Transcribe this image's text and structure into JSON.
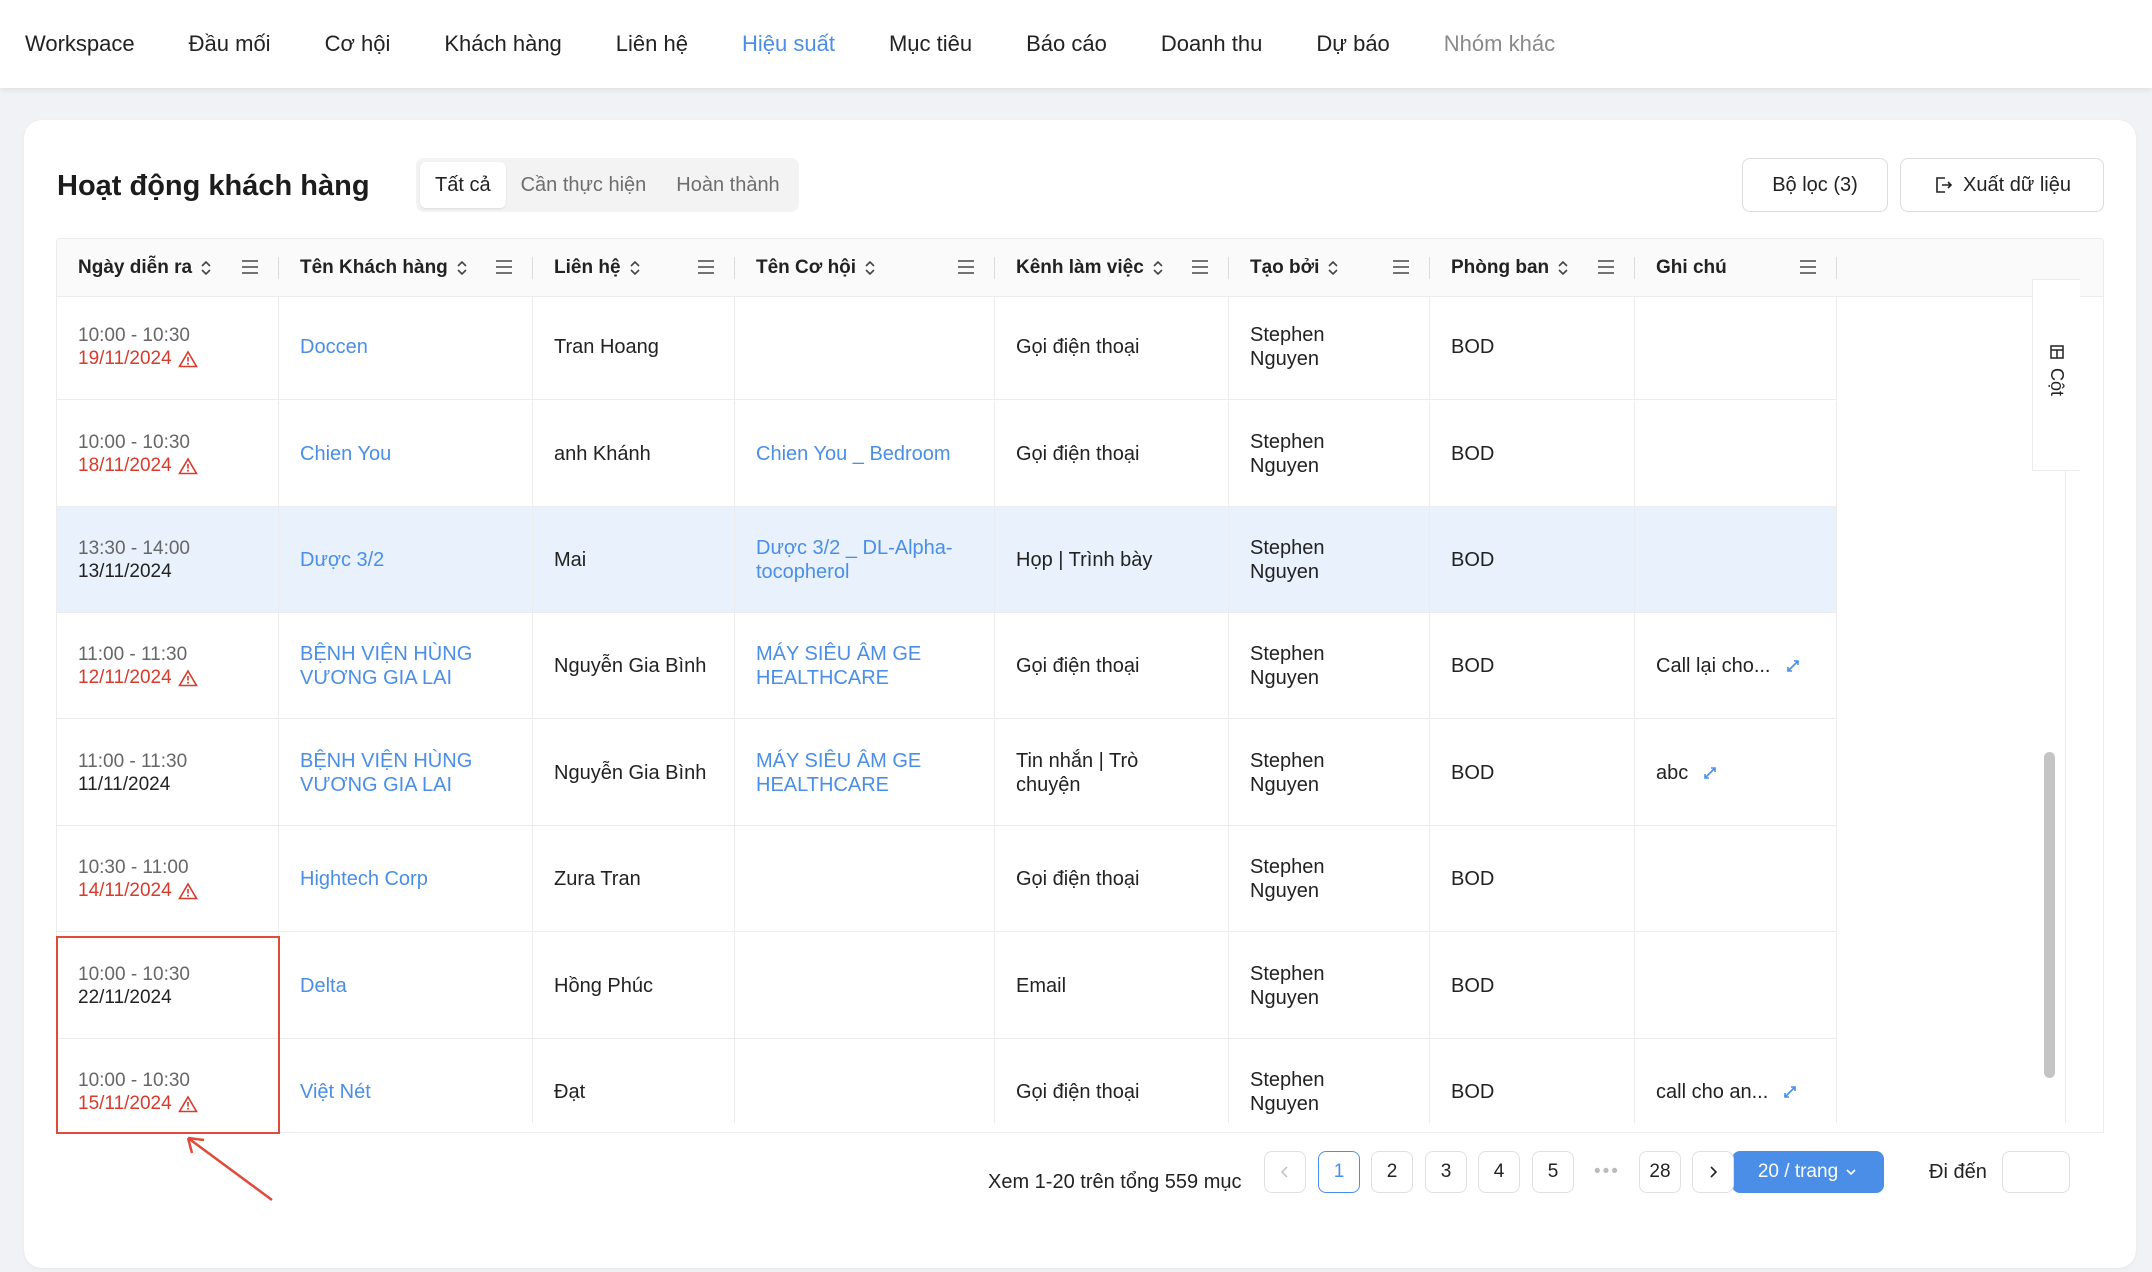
{
  "nav": {
    "items": [
      "Workspace",
      "Đầu mối",
      "Cơ hội",
      "Khách hàng",
      "Liên hệ",
      "Hiệu suất",
      "Mục tiêu",
      "Báo cáo",
      "Doanh thu",
      "Dự báo",
      "Nhóm khác"
    ],
    "active_index": 5
  },
  "card": {
    "title": "Hoạt động khách hàng",
    "segments": [
      "Tất cả",
      "Cần thực hiện",
      "Hoàn thành"
    ],
    "active_segment": 0,
    "filter_label": "Bộ lọc (3)",
    "export_label": "Xuất dữ liệu"
  },
  "table": {
    "columns": [
      "Ngày diễn ra",
      "Tên Khách hàng",
      "Liên hệ",
      "Tên Cơ hội",
      "Kênh làm việc",
      "Tạo bởi",
      "Phòng ban",
      "Ghi chú"
    ],
    "rows": [
      {
        "time": "10:00 - 10:30",
        "date": "19/11/2024",
        "overdue": true,
        "customer": "Doccen",
        "contact": "Tran Hoang",
        "opportunity": "",
        "channel": "Gọi điện thoại",
        "creator": "Stephen Nguyen",
        "dept": "BOD",
        "note": ""
      },
      {
        "time": "10:00 - 10:30",
        "date": "18/11/2024",
        "overdue": true,
        "customer": "Chien You",
        "contact": "anh Khánh",
        "opportunity": "Chien You _ Bedroom",
        "channel": "Gọi điện thoại",
        "creator": "Stephen Nguyen",
        "dept": "BOD",
        "note": ""
      },
      {
        "time": "13:30 - 14:00",
        "date": "13/11/2024",
        "overdue": false,
        "customer": "Dược 3/2",
        "contact": "Mai",
        "opportunity": "Dược 3/2 _ DL-Alpha-tocopherol",
        "channel": "Họp | Trình bày",
        "creator": "Stephen Nguyen",
        "dept": "BOD",
        "note": "",
        "highlighted": true
      },
      {
        "time": "11:00 - 11:30",
        "date": "12/11/2024",
        "overdue": true,
        "customer": "BỆNH VIỆN HÙNG VƯƠNG GIA LAI",
        "contact": "Nguyễn Gia Bình",
        "opportunity": "MÁY SIÊU ÂM GE HEALTHCARE",
        "channel": "Gọi điện thoại",
        "creator": "Stephen Nguyen",
        "dept": "BOD",
        "note": "Call lại cho..."
      },
      {
        "time": "11:00 - 11:30",
        "date": "11/11/2024",
        "overdue": false,
        "customer": "BỆNH VIỆN HÙNG VƯƠNG GIA LAI",
        "contact": "Nguyễn Gia Bình",
        "opportunity": "MÁY SIÊU ÂM GE HEALTHCARE",
        "channel": "Tin nhắn | Trò chuyện",
        "creator": "Stephen Nguyen",
        "dept": "BOD",
        "note": "abc"
      },
      {
        "time": "10:30 - 11:00",
        "date": "14/11/2024",
        "overdue": true,
        "customer": "Hightech Corp",
        "contact": "Zura Tran",
        "opportunity": "",
        "channel": "Gọi điện thoại",
        "creator": "Stephen Nguyen",
        "dept": "BOD",
        "note": ""
      },
      {
        "time": "10:00 - 10:30",
        "date": "22/11/2024",
        "overdue": false,
        "customer": "Delta",
        "contact": "Hồng Phúc",
        "opportunity": "",
        "channel": "Email",
        "creator": "Stephen Nguyen",
        "dept": "BOD",
        "note": ""
      },
      {
        "time": "10:00 - 10:30",
        "date": "15/11/2024",
        "overdue": true,
        "customer": "Việt Nét",
        "contact": "Đạt",
        "opportunity": "",
        "channel": "Gọi điện thoại",
        "creator": "Stephen Nguyen",
        "dept": "BOD",
        "note": "call cho an..."
      }
    ],
    "column_toggle_label": "Cột"
  },
  "pagination": {
    "summary": "Xem 1-20 trên tổng 559 mục",
    "pages": [
      "1",
      "2",
      "3",
      "4",
      "5"
    ],
    "ellipsis": "•••",
    "last_page": "28",
    "current_page": 1,
    "page_size_label": "20 / trang",
    "goto_label": "Đi đến"
  },
  "icons": {
    "sort": "sort-icon",
    "menu": "column-menu-icon",
    "warning": "warning-triangle-icon",
    "expand": "expand-icon",
    "export": "export-icon",
    "columns": "columns-icon"
  },
  "colors": {
    "accent": "#4a8ee8",
    "overdue": "#d93a2b",
    "highlight_row": "#e8f1fc",
    "annotation": "#e04a3a"
  }
}
